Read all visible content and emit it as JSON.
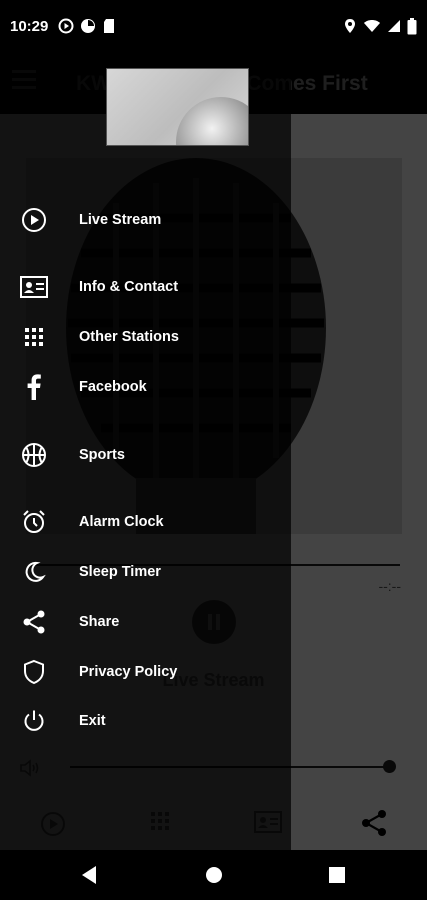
{
  "status_bar": {
    "time": "10:29"
  },
  "app": {
    "title": "KWBC — Sports Comes First",
    "time_remaining": "--:--",
    "now_playing": "Live Stream"
  },
  "drawer": {
    "items": [
      {
        "label": "Live Stream",
        "icon": "play-circle-icon"
      },
      {
        "label": "Info & Contact",
        "icon": "contact-card-icon"
      },
      {
        "label": "Other Stations",
        "icon": "grid-icon"
      },
      {
        "label": "Facebook",
        "icon": "facebook-icon"
      },
      {
        "label": "Sports",
        "icon": "basketball-icon"
      },
      {
        "label": "Alarm Clock",
        "icon": "alarm-clock-icon"
      },
      {
        "label": "Sleep Timer",
        "icon": "moon-icon"
      },
      {
        "label": "Share",
        "icon": "share-icon"
      },
      {
        "label": "Privacy Policy",
        "icon": "shield-icon"
      },
      {
        "label": "Exit",
        "icon": "power-icon"
      }
    ]
  },
  "colors": {
    "drawer_bg": "#000000",
    "app_bg": "#7c7c7c",
    "text": "#ffffff"
  }
}
